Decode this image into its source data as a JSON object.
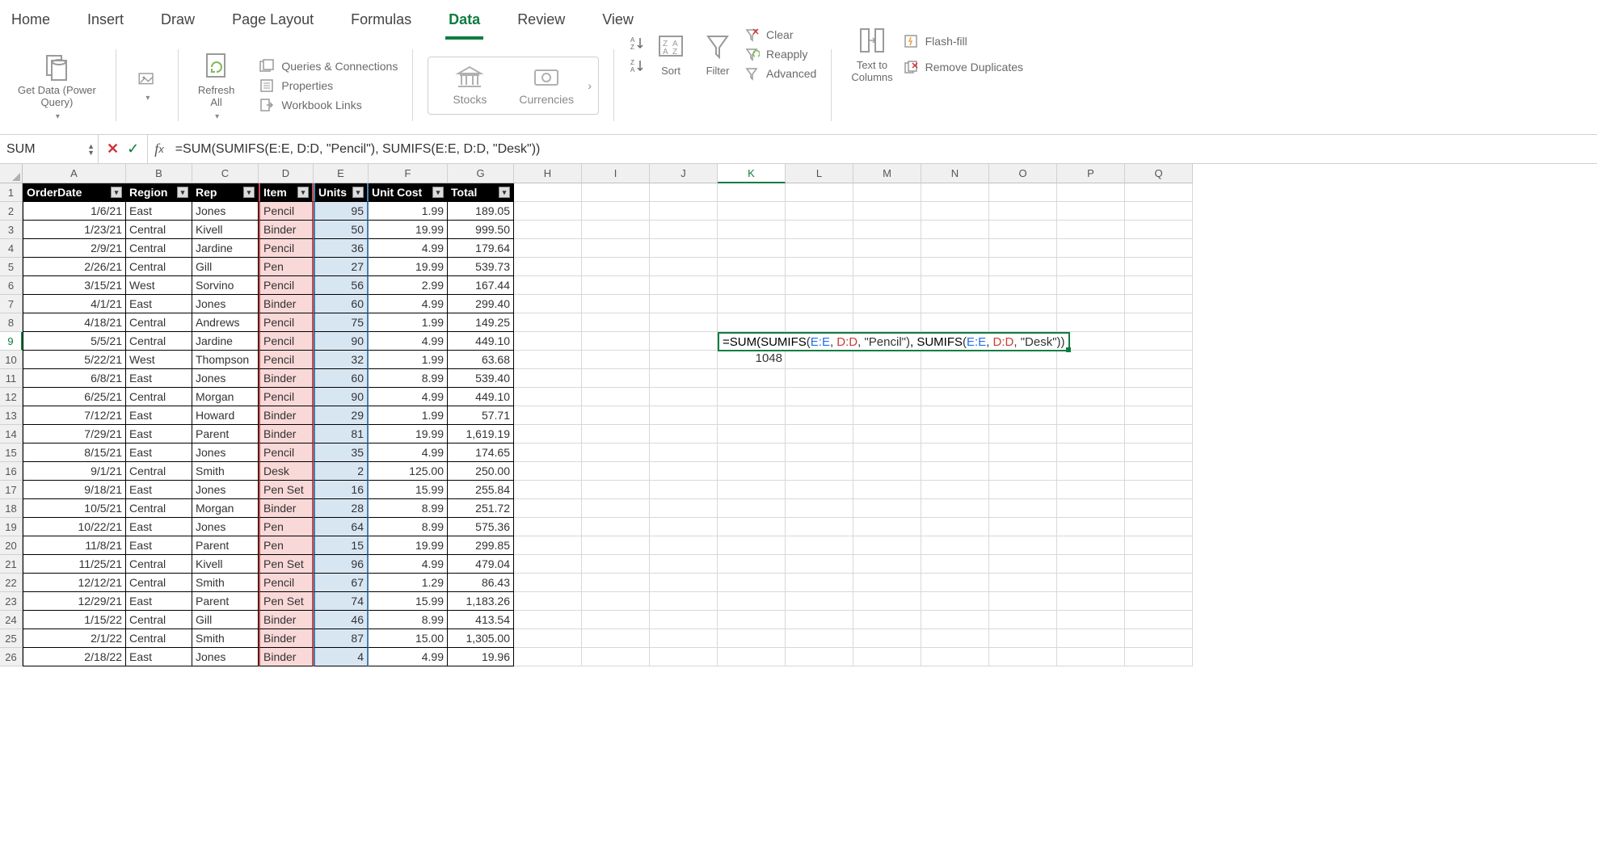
{
  "tabs": [
    "Home",
    "Insert",
    "Draw",
    "Page Layout",
    "Formulas",
    "Data",
    "Review",
    "View"
  ],
  "active_tab": "Data",
  "ribbon": {
    "get_data": "Get Data (Power\nQuery)",
    "refresh": "Refresh\nAll",
    "queries": "Queries & Connections",
    "properties": "Properties",
    "workbook_links": "Workbook Links",
    "stocks": "Stocks",
    "currencies": "Currencies",
    "sort": "Sort",
    "filter": "Filter",
    "clear": "Clear",
    "reapply": "Reapply",
    "advanced": "Advanced",
    "text_to_cols": "Text to\nColumns",
    "flash_fill": "Flash-fill",
    "remove_dupes": "Remove Duplicates"
  },
  "namebox": "SUM",
  "formula": "=SUM(SUMIFS(E:E, D:D, \"Pencil\"), SUMIFS(E:E, D:D, \"Desk\"))",
  "columns": [
    "A",
    "B",
    "C",
    "D",
    "E",
    "F",
    "G",
    "H",
    "I",
    "J",
    "K",
    "L",
    "M",
    "N",
    "O",
    "P",
    "Q"
  ],
  "active_col": "K",
  "active_row": 9,
  "headers": [
    "OrderDate",
    "Region",
    "Rep",
    "Item",
    "Units",
    "Unit Cost",
    "Total"
  ],
  "rows": [
    [
      "1/6/21",
      "East",
      "Jones",
      "Pencil",
      "95",
      "1.99",
      "189.05"
    ],
    [
      "1/23/21",
      "Central",
      "Kivell",
      "Binder",
      "50",
      "19.99",
      "999.50"
    ],
    [
      "2/9/21",
      "Central",
      "Jardine",
      "Pencil",
      "36",
      "4.99",
      "179.64"
    ],
    [
      "2/26/21",
      "Central",
      "Gill",
      "Pen",
      "27",
      "19.99",
      "539.73"
    ],
    [
      "3/15/21",
      "West",
      "Sorvino",
      "Pencil",
      "56",
      "2.99",
      "167.44"
    ],
    [
      "4/1/21",
      "East",
      "Jones",
      "Binder",
      "60",
      "4.99",
      "299.40"
    ],
    [
      "4/18/21",
      "Central",
      "Andrews",
      "Pencil",
      "75",
      "1.99",
      "149.25"
    ],
    [
      "5/5/21",
      "Central",
      "Jardine",
      "Pencil",
      "90",
      "4.99",
      "449.10"
    ],
    [
      "5/22/21",
      "West",
      "Thompson",
      "Pencil",
      "32",
      "1.99",
      "63.68"
    ],
    [
      "6/8/21",
      "East",
      "Jones",
      "Binder",
      "60",
      "8.99",
      "539.40"
    ],
    [
      "6/25/21",
      "Central",
      "Morgan",
      "Pencil",
      "90",
      "4.99",
      "449.10"
    ],
    [
      "7/12/21",
      "East",
      "Howard",
      "Binder",
      "29",
      "1.99",
      "57.71"
    ],
    [
      "7/29/21",
      "East",
      "Parent",
      "Binder",
      "81",
      "19.99",
      "1,619.19"
    ],
    [
      "8/15/21",
      "East",
      "Jones",
      "Pencil",
      "35",
      "4.99",
      "174.65"
    ],
    [
      "9/1/21",
      "Central",
      "Smith",
      "Desk",
      "2",
      "125.00",
      "250.00"
    ],
    [
      "9/18/21",
      "East",
      "Jones",
      "Pen Set",
      "16",
      "15.99",
      "255.84"
    ],
    [
      "10/5/21",
      "Central",
      "Morgan",
      "Binder",
      "28",
      "8.99",
      "251.72"
    ],
    [
      "10/22/21",
      "East",
      "Jones",
      "Pen",
      "64",
      "8.99",
      "575.36"
    ],
    [
      "11/8/21",
      "East",
      "Parent",
      "Pen",
      "15",
      "19.99",
      "299.85"
    ],
    [
      "11/25/21",
      "Central",
      "Kivell",
      "Pen Set",
      "96",
      "4.99",
      "479.04"
    ],
    [
      "12/12/21",
      "Central",
      "Smith",
      "Pencil",
      "67",
      "1.29",
      "86.43"
    ],
    [
      "12/29/21",
      "East",
      "Parent",
      "Pen Set",
      "74",
      "15.99",
      "1,183.26"
    ],
    [
      "1/15/22",
      "Central",
      "Gill",
      "Binder",
      "46",
      "8.99",
      "413.54"
    ],
    [
      "2/1/22",
      "Central",
      "Smith",
      "Binder",
      "87",
      "15.00",
      "1,305.00"
    ],
    [
      "2/18/22",
      "East",
      "Jones",
      "Binder",
      "4",
      "4.99",
      "19.96"
    ]
  ],
  "overlay": {
    "formula_parts": {
      "p1": "=SUM(SUMIFS",
      "p2": "(",
      "p3": "E:E",
      "p4": ", ",
      "p5": "D:D",
      "p6": ", \"Pencil\"",
      "p7": ")",
      "p8": ", SUMIFS",
      "p9": "(",
      "p10": "E:E",
      "p11": ", ",
      "p12": "D:D",
      "p13": ", \"Desk\"",
      "p14": "))"
    },
    "result": "1048"
  }
}
